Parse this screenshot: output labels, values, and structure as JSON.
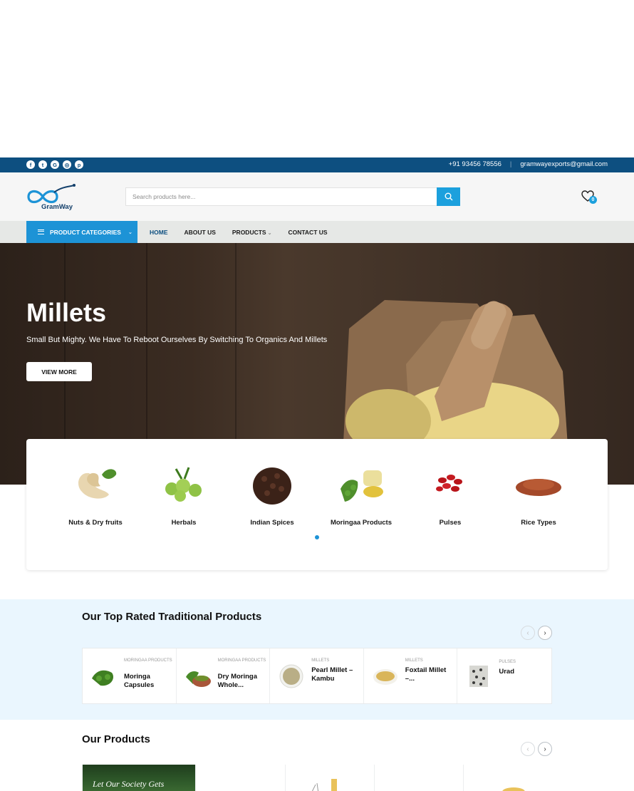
{
  "topbar": {
    "social": [
      "f",
      "t",
      "G",
      "◎",
      "p"
    ],
    "phone": "+91 93456 78556",
    "separator": "|",
    "email": "gramwayexports@gmail.com"
  },
  "header": {
    "logo_text": "GramWay",
    "search_placeholder": "Search products here...",
    "wishlist_count": "0"
  },
  "nav": {
    "categories_label": "PRODUCT CATEGORIES",
    "items": [
      "HOME",
      "ABOUT US",
      "PRODUCTS",
      "CONTACT US"
    ]
  },
  "hero": {
    "title": "Millets",
    "subtitle": "Small But Mighty. We Have To Reboot Ourselves By Switching To Organics And Millets",
    "button": "VIEW MORE"
  },
  "categories": [
    {
      "label": "Nuts & Dry fruits",
      "icon": "cashew-icon"
    },
    {
      "label": "Herbals",
      "icon": "amla-icon"
    },
    {
      "label": "Indian Spices",
      "icon": "cloves-icon"
    },
    {
      "label": "Moringaa Products",
      "icon": "moringa-oil-icon"
    },
    {
      "label": "Pulses",
      "icon": "beans-icon"
    },
    {
      "label": "Rice Types",
      "icon": "rice-icon"
    }
  ],
  "top_rated": {
    "title": "Our Top Rated Traditional Products",
    "items": [
      {
        "category": "MORINGAA PRODUCTS",
        "name": "Moringa Capsules"
      },
      {
        "category": "MORINGAA PRODUCTS",
        "name": "Dry Moringa Whole..."
      },
      {
        "category": "MILLETS",
        "name": "Pearl Millet – Kambu"
      },
      {
        "category": "MILLETS",
        "name": "Foxtail Millet –..."
      },
      {
        "category": "PULSES",
        "name": "Urad"
      }
    ]
  },
  "our_products": {
    "title": "Our Products",
    "promo_text": "Let Our Society Gets"
  },
  "colors": {
    "topbar": "#0d4f80",
    "accent": "#1d93d6",
    "section_bg": "#eaf6fe"
  }
}
